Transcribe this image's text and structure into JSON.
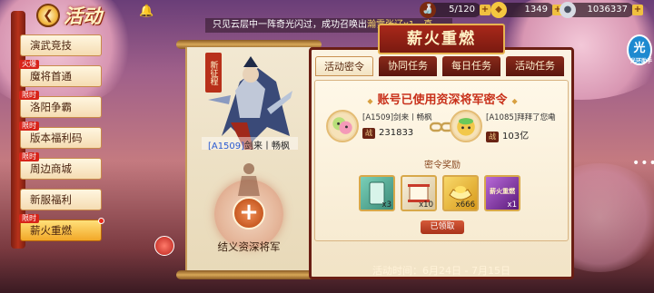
{
  "header": {
    "title": "活动",
    "notice_prefix": "只见云层中一阵奇光闪过，成功召唤出",
    "notice_highlight": "瀚雪张辽x1，真"
  },
  "resources": [
    {
      "name": "stamina",
      "icon": "wine-cup-icon",
      "value": "5/120"
    },
    {
      "name": "ingots",
      "icon": "gold-ingot-icon",
      "value": "1349"
    },
    {
      "name": "silver",
      "icon": "silver-coin-icon",
      "value": "1036337"
    }
  ],
  "sidebar": {
    "items": [
      {
        "label": "演武竞技",
        "tag": ""
      },
      {
        "label": "魔将首通",
        "tag": "火爆"
      },
      {
        "label": "洛阳争霸",
        "tag": "限时"
      },
      {
        "label": "版本福利码",
        "tag": "限时"
      },
      {
        "label": "周边商城",
        "tag": "限时"
      },
      {
        "label": "新服福利",
        "tag": ""
      },
      {
        "label": "薪火重燃",
        "tag": "限时"
      }
    ]
  },
  "scroll": {
    "badge": "新征程",
    "hero_id": "[A1509]",
    "hero_name": "剑来丨畅枫",
    "bind_caption": "结义资深将军"
  },
  "panel": {
    "title": "薪火重燃",
    "tabs": [
      "活动密令",
      "协同任务",
      "每日任务",
      "活动任务"
    ],
    "active_tab": 0,
    "content_title": "账号已使用资深将军密令",
    "players": [
      {
        "name": "[A1509]剑来丨畅枫",
        "power_label": "战",
        "power": "231833"
      },
      {
        "name": "[A1085]拜拜了您嘞",
        "power_label": "战",
        "power": "103亿"
      }
    ],
    "reward_title": "密令奖励",
    "rewards": [
      {
        "name": "card",
        "count": "x3",
        "color": "#4aa888"
      },
      {
        "name": "scroll",
        "count": "x10",
        "color": "#e8dcc0"
      },
      {
        "name": "gold-ingot",
        "count": "x666",
        "color": "#f0c040"
      },
      {
        "name": "title-badge",
        "count": "x1",
        "color": "#8a3aa8"
      }
    ],
    "reward_badge_text": "薪火重燃",
    "claim_label": "已领取"
  },
  "footer": {
    "time_label": "活动时间：",
    "time_range": "6月24日 - 7月15日"
  },
  "corner": {
    "icon": "光",
    "label": "光环助手"
  },
  "chat": "•••"
}
